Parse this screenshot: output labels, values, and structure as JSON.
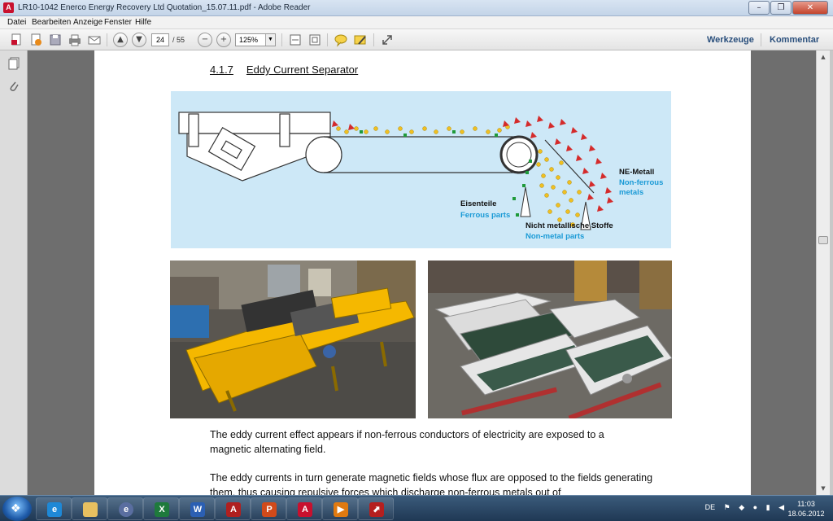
{
  "window": {
    "title": "LR10-1042 Enerco Energy Recovery Ltd Quotation_15.07.11.pdf - Adobe Reader",
    "minimize": "–",
    "maximize": "❐",
    "close": "✕"
  },
  "menu": [
    "Datei",
    "Bearbeiten",
    "Anzeige",
    "Fenster",
    "Hilfe"
  ],
  "toolbar": {
    "page_current": "24",
    "page_total": "/ 55",
    "zoom": "125%",
    "tools_label": "Werkzeuge",
    "comment_label": "Kommentar"
  },
  "document": {
    "section_number": "4.1.7",
    "section_title": "Eddy Current Separator",
    "diagram_labels": {
      "ne_metal_de": "NE-Metall",
      "ne_metal_en_1": "Non-ferrous",
      "ne_metal_en_2": "metals",
      "ferrous_de": "Eisenteile",
      "ferrous_en": "Ferrous parts",
      "nonmetal_de": "Nicht metallische Stoffe",
      "nonmetal_en": "Non-metal parts"
    },
    "paragraph_1": "The eddy current effect appears if non-ferrous conductors of electricity are exposed to a magnetic alternating field.",
    "paragraph_2": "The eddy currents in turn generate magnetic fields whose flux are opposed to the fields generating them, thus causing repulsive forces which discharge non-ferrous metals out of"
  },
  "taskbar": {
    "language": "DE",
    "time": "11:03",
    "date": "18.06.2012",
    "apps": [
      "internet-explorer",
      "file-explorer",
      "browser",
      "excel",
      "word",
      "autocad",
      "powerpoint",
      "adobe-reader",
      "media-player",
      "pdf-tool"
    ]
  },
  "colors": {
    "diagram_bg": "#cde8f7",
    "label_blue": "#1a9ad6",
    "triangle_red": "#d42b2b",
    "dot_yellow": "#f0c020",
    "square_green": "#1f9a3a",
    "machine_yellow": "#f5b800"
  }
}
